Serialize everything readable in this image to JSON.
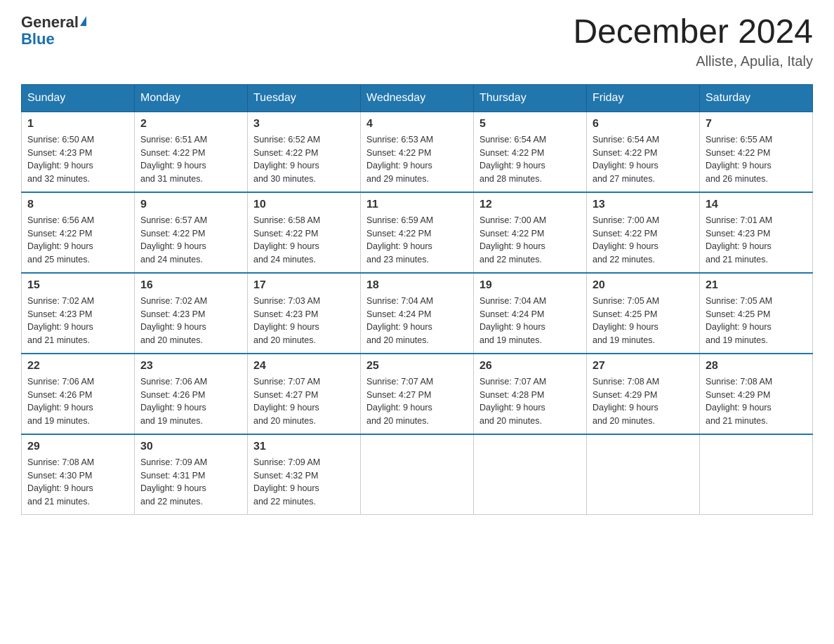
{
  "header": {
    "logo_line1": "General",
    "logo_line2": "Blue",
    "month_title": "December 2024",
    "location": "Alliste, Apulia, Italy"
  },
  "weekdays": [
    "Sunday",
    "Monday",
    "Tuesday",
    "Wednesday",
    "Thursday",
    "Friday",
    "Saturday"
  ],
  "weeks": [
    [
      {
        "day": "1",
        "sunrise": "6:50 AM",
        "sunset": "4:23 PM",
        "daylight": "9 hours and 32 minutes."
      },
      {
        "day": "2",
        "sunrise": "6:51 AM",
        "sunset": "4:22 PM",
        "daylight": "9 hours and 31 minutes."
      },
      {
        "day": "3",
        "sunrise": "6:52 AM",
        "sunset": "4:22 PM",
        "daylight": "9 hours and 30 minutes."
      },
      {
        "day": "4",
        "sunrise": "6:53 AM",
        "sunset": "4:22 PM",
        "daylight": "9 hours and 29 minutes."
      },
      {
        "day": "5",
        "sunrise": "6:54 AM",
        "sunset": "4:22 PM",
        "daylight": "9 hours and 28 minutes."
      },
      {
        "day": "6",
        "sunrise": "6:54 AM",
        "sunset": "4:22 PM",
        "daylight": "9 hours and 27 minutes."
      },
      {
        "day": "7",
        "sunrise": "6:55 AM",
        "sunset": "4:22 PM",
        "daylight": "9 hours and 26 minutes."
      }
    ],
    [
      {
        "day": "8",
        "sunrise": "6:56 AM",
        "sunset": "4:22 PM",
        "daylight": "9 hours and 25 minutes."
      },
      {
        "day": "9",
        "sunrise": "6:57 AM",
        "sunset": "4:22 PM",
        "daylight": "9 hours and 24 minutes."
      },
      {
        "day": "10",
        "sunrise": "6:58 AM",
        "sunset": "4:22 PM",
        "daylight": "9 hours and 24 minutes."
      },
      {
        "day": "11",
        "sunrise": "6:59 AM",
        "sunset": "4:22 PM",
        "daylight": "9 hours and 23 minutes."
      },
      {
        "day": "12",
        "sunrise": "7:00 AM",
        "sunset": "4:22 PM",
        "daylight": "9 hours and 22 minutes."
      },
      {
        "day": "13",
        "sunrise": "7:00 AM",
        "sunset": "4:22 PM",
        "daylight": "9 hours and 22 minutes."
      },
      {
        "day": "14",
        "sunrise": "7:01 AM",
        "sunset": "4:23 PM",
        "daylight": "9 hours and 21 minutes."
      }
    ],
    [
      {
        "day": "15",
        "sunrise": "7:02 AM",
        "sunset": "4:23 PM",
        "daylight": "9 hours and 21 minutes."
      },
      {
        "day": "16",
        "sunrise": "7:02 AM",
        "sunset": "4:23 PM",
        "daylight": "9 hours and 20 minutes."
      },
      {
        "day": "17",
        "sunrise": "7:03 AM",
        "sunset": "4:23 PM",
        "daylight": "9 hours and 20 minutes."
      },
      {
        "day": "18",
        "sunrise": "7:04 AM",
        "sunset": "4:24 PM",
        "daylight": "9 hours and 20 minutes."
      },
      {
        "day": "19",
        "sunrise": "7:04 AM",
        "sunset": "4:24 PM",
        "daylight": "9 hours and 19 minutes."
      },
      {
        "day": "20",
        "sunrise": "7:05 AM",
        "sunset": "4:25 PM",
        "daylight": "9 hours and 19 minutes."
      },
      {
        "day": "21",
        "sunrise": "7:05 AM",
        "sunset": "4:25 PM",
        "daylight": "9 hours and 19 minutes."
      }
    ],
    [
      {
        "day": "22",
        "sunrise": "7:06 AM",
        "sunset": "4:26 PM",
        "daylight": "9 hours and 19 minutes."
      },
      {
        "day": "23",
        "sunrise": "7:06 AM",
        "sunset": "4:26 PM",
        "daylight": "9 hours and 19 minutes."
      },
      {
        "day": "24",
        "sunrise": "7:07 AM",
        "sunset": "4:27 PM",
        "daylight": "9 hours and 20 minutes."
      },
      {
        "day": "25",
        "sunrise": "7:07 AM",
        "sunset": "4:27 PM",
        "daylight": "9 hours and 20 minutes."
      },
      {
        "day": "26",
        "sunrise": "7:07 AM",
        "sunset": "4:28 PM",
        "daylight": "9 hours and 20 minutes."
      },
      {
        "day": "27",
        "sunrise": "7:08 AM",
        "sunset": "4:29 PM",
        "daylight": "9 hours and 20 minutes."
      },
      {
        "day": "28",
        "sunrise": "7:08 AM",
        "sunset": "4:29 PM",
        "daylight": "9 hours and 21 minutes."
      }
    ],
    [
      {
        "day": "29",
        "sunrise": "7:08 AM",
        "sunset": "4:30 PM",
        "daylight": "9 hours and 21 minutes."
      },
      {
        "day": "30",
        "sunrise": "7:09 AM",
        "sunset": "4:31 PM",
        "daylight": "9 hours and 22 minutes."
      },
      {
        "day": "31",
        "sunrise": "7:09 AM",
        "sunset": "4:32 PM",
        "daylight": "9 hours and 22 minutes."
      },
      null,
      null,
      null,
      null
    ]
  ],
  "labels": {
    "sunrise": "Sunrise:",
    "sunset": "Sunset:",
    "daylight": "Daylight:"
  }
}
